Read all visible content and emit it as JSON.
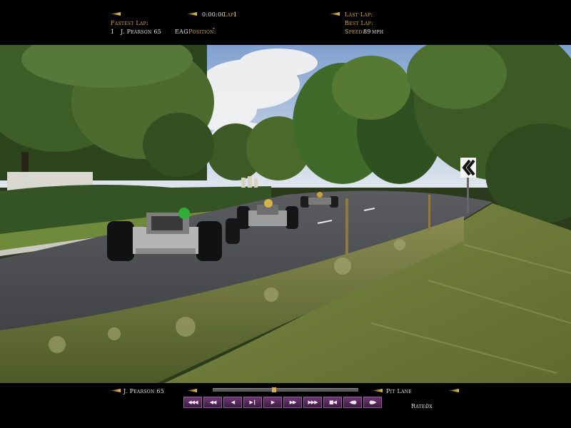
{
  "top_hud": {
    "race_time": "0:00:00",
    "lap_label": "Lap:",
    "lap_value": "1",
    "fastest_lap_label": "Fastest Lap:",
    "fastest_lap_position": "1",
    "fastest_lap_driver": "J. Pearson 65",
    "car_code": "EAG",
    "position_label": "Position:",
    "position_value": "″",
    "last_lap_label": "Last Lap:",
    "best_lap_label": "Best Lap:",
    "speed_label": "Speed:",
    "speed_value": "89",
    "speed_unit": "mph"
  },
  "bottom_hud": {
    "driver_name": "J. Pearson 65",
    "camera_label": "Pit Lane",
    "rate_label": "Rate:",
    "rate_value": "0x",
    "replay_progress": 0.42,
    "controls": [
      "◀◀◀",
      "◀◀",
      "◀",
      "▶❙",
      "▶",
      "▶▶",
      "▶▶▶",
      "■◀",
      "◀●",
      "●▶"
    ]
  },
  "icons": [
    "arrow-pointer-icon",
    "chevron-sign-icon"
  ],
  "colors": {
    "hud_gold": "#d9a93a",
    "hud_white": "#e6e6e6",
    "control_purple": "#6d3672"
  }
}
